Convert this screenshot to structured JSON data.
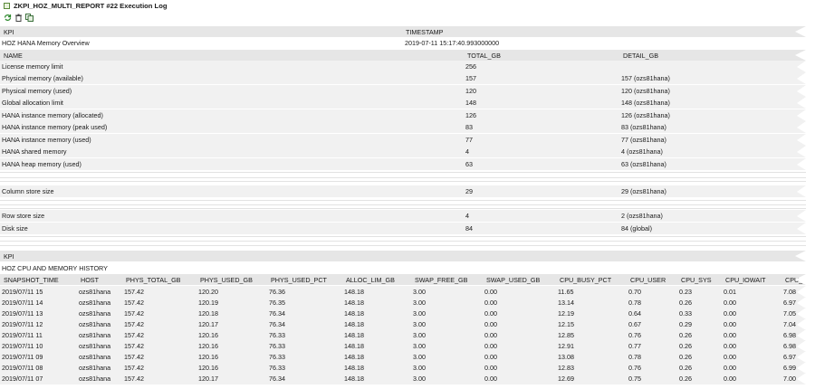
{
  "window": {
    "title": "ZKPI_HOZ_MULTI_REPORT #22 Execution Log"
  },
  "toolbar": {
    "buttons": [
      "refresh-icon",
      "delete-icon",
      "copy-icon"
    ]
  },
  "kpi_header": {
    "col_kpi": "KPI",
    "col_timestamp": "TIMESTAMP"
  },
  "kpi_row1": {
    "name": "HOZ HANA Memory Overview",
    "timestamp": "2019-07-11 15:17:40.993000000"
  },
  "mem_header": {
    "col_name": "NAME",
    "col_total": "TOTAL_GB",
    "col_detail": "DETAIL_GB"
  },
  "memory": [
    {
      "name": "License memory limit",
      "total": "256",
      "detail": ""
    },
    {
      "name": "Physical memory (available)",
      "total": "157",
      "detail": "157 (ozs81hana)"
    },
    {
      "name": "Physical memory (used)",
      "total": "120",
      "detail": "120 (ozs81hana)"
    },
    {
      "name": "Global allocation limit",
      "total": "148",
      "detail": "148 (ozs81hana)"
    },
    {
      "name": "HANA instance memory (allocated)",
      "total": "126",
      "detail": "126 (ozs81hana)"
    },
    {
      "name": "HANA instance memory (peak used)",
      "total": "83",
      "detail": "83 (ozs81hana)"
    },
    {
      "name": "HANA instance memory (used)",
      "total": "77",
      "detail": "77 (ozs81hana)"
    },
    {
      "name": "HANA shared memory",
      "total": "4",
      "detail": "4 (ozs81hana)"
    },
    {
      "name": "HANA heap memory (used)",
      "total": "63",
      "detail": "63 (ozs81hana)"
    },
    {
      "name": "Column store size",
      "total": "29",
      "detail": "29 (ozs81hana)"
    },
    {
      "name": "Row store size",
      "total": "4",
      "detail": "2 (ozs81hana)"
    },
    {
      "name": "Disk size",
      "total": "84",
      "detail": "84 (global)"
    }
  ],
  "kpi_header2": {
    "col_kpi": "KPI"
  },
  "kpi_row2": {
    "name": "HOZ CPU AND MEMORY HISTORY"
  },
  "cpu_header": [
    "SNAPSHOT_TIME",
    "HOST",
    "PHYS_TOTAL_GB",
    "PHYS_USED_GB",
    "PHYS_USED_PCT",
    "ALLOC_LIM_GB",
    "SWAP_FREE_GB",
    "SWAP_USED_GB",
    "CPU_BUSY_PCT",
    "CPU_USER",
    "CPU_SYS",
    "CPU_IOWAIT",
    "CPU_IDI"
  ],
  "cpu_rows": [
    [
      "2019/07/11 15",
      "ozs81hana",
      "157.42",
      "120.20",
      "76.36",
      "148.18",
      "3.00",
      "0.00",
      "11.65",
      "0.70",
      "0.23",
      "0.01",
      "7.08"
    ],
    [
      "2019/07/11 14",
      "ozs81hana",
      "157.42",
      "120.19",
      "76.35",
      "148.18",
      "3.00",
      "0.00",
      "13.14",
      "0.78",
      "0.26",
      "0.00",
      "6.97"
    ],
    [
      "2019/07/11 13",
      "ozs81hana",
      "157.42",
      "120.18",
      "76.34",
      "148.18",
      "3.00",
      "0.00",
      "12.19",
      "0.64",
      "0.33",
      "0.00",
      "7.05"
    ],
    [
      "2019/07/11 12",
      "ozs81hana",
      "157.42",
      "120.17",
      "76.34",
      "148.18",
      "3.00",
      "0.00",
      "12.15",
      "0.67",
      "0.29",
      "0.00",
      "7.04"
    ],
    [
      "2019/07/11 11",
      "ozs81hana",
      "157.42",
      "120.16",
      "76.33",
      "148.18",
      "3.00",
      "0.00",
      "12.85",
      "0.76",
      "0.26",
      "0.00",
      "6.98"
    ],
    [
      "2019/07/11 10",
      "ozs81hana",
      "157.42",
      "120.16",
      "76.33",
      "148.18",
      "3.00",
      "0.00",
      "12.91",
      "0.77",
      "0.26",
      "0.00",
      "6.98"
    ],
    [
      "2019/07/11 09",
      "ozs81hana",
      "157.42",
      "120.16",
      "76.33",
      "148.18",
      "3.00",
      "0.00",
      "13.08",
      "0.78",
      "0.26",
      "0.00",
      "6.97"
    ],
    [
      "2019/07/11 08",
      "ozs81hana",
      "157.42",
      "120.16",
      "76.33",
      "148.18",
      "3.00",
      "0.00",
      "12.83",
      "0.76",
      "0.26",
      "0.00",
      "6.99"
    ],
    [
      "2019/07/11 07",
      "ozs81hana",
      "157.42",
      "120.17",
      "76.34",
      "148.18",
      "3.00",
      "0.00",
      "12.69",
      "0.75",
      "0.26",
      "0.00",
      "7.00"
    ]
  ]
}
